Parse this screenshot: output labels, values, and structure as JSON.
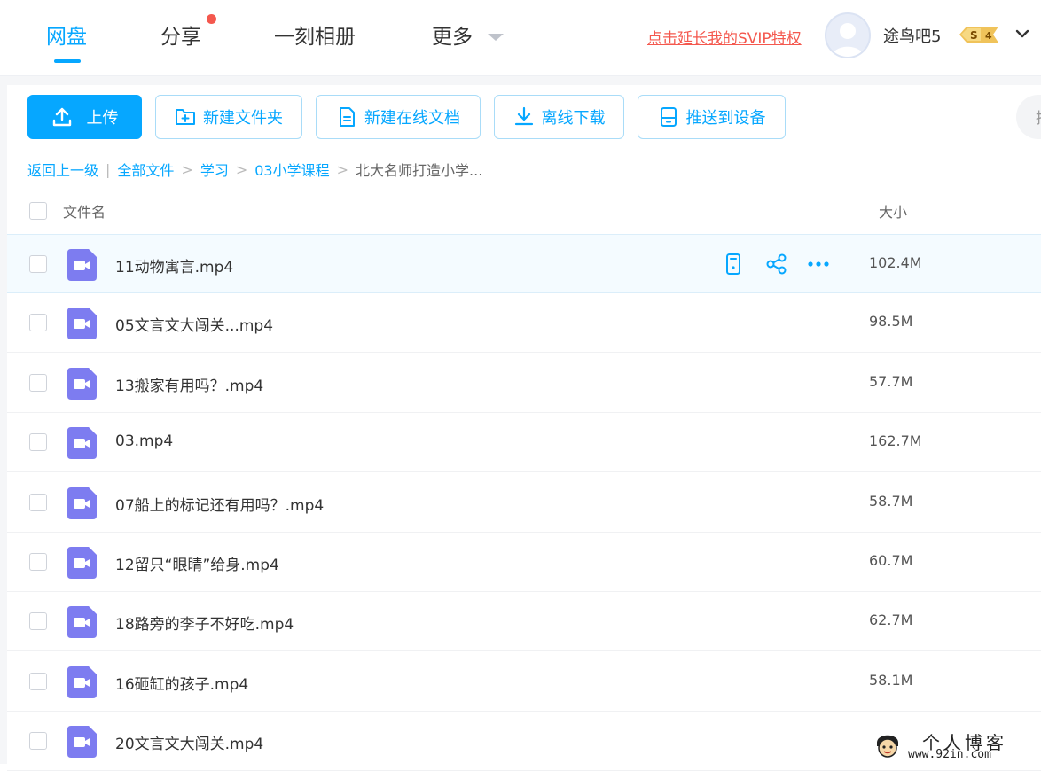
{
  "nav": {
    "tabs": [
      {
        "label": "网盘",
        "active": true
      },
      {
        "label": "分享",
        "has_dot": true
      },
      {
        "label": "一刻相册"
      },
      {
        "label": "更多",
        "has_caret": true
      }
    ],
    "svip_link": "点击延长我的SVIP特权",
    "username": "途鸟吧5",
    "vip_level": "4",
    "vip_letter": "S"
  },
  "toolbar": {
    "upload": "上传",
    "new_folder": "新建文件夹",
    "new_doc": "新建在线文档",
    "offline_download": "离线下载",
    "push_device": "推送到设备",
    "side_partial": "拍"
  },
  "breadcrumb": {
    "back": "返回上一级",
    "sep_bar": "|",
    "items": [
      "全部文件",
      "学习",
      "03小学课程"
    ],
    "current": "北大名师打造小学..."
  },
  "table": {
    "col_name": "文件名",
    "col_size": "大小",
    "rows": [
      {
        "name": "11动物寓言.mp4",
        "size": "102.4M"
      },
      {
        "name": "05文言文大闯关...mp4",
        "size": "98.5M"
      },
      {
        "name": "13搬家有用吗？.mp4",
        "size": "57.7M"
      },
      {
        "name": "03.mp4",
        "size": "162.7M"
      },
      {
        "name": "07船上的标记还有用吗？.mp4",
        "size": "58.7M"
      },
      {
        "name": "12留只“眼睛”给身.mp4",
        "size": "60.7M"
      },
      {
        "name": "18路旁的李子不好吃.mp4",
        "size": "62.7M"
      },
      {
        "name": "16砸缸的孩子.mp4",
        "size": "58.1M"
      },
      {
        "name": "20文言文大闯关.mp4",
        "size": ""
      }
    ]
  },
  "watermark": {
    "title": "个人博客",
    "url": "www.92in.com"
  },
  "colors": {
    "accent": "#06a7ff",
    "video_icon": "#7d7cf0",
    "svip_red": "#f4584e"
  }
}
